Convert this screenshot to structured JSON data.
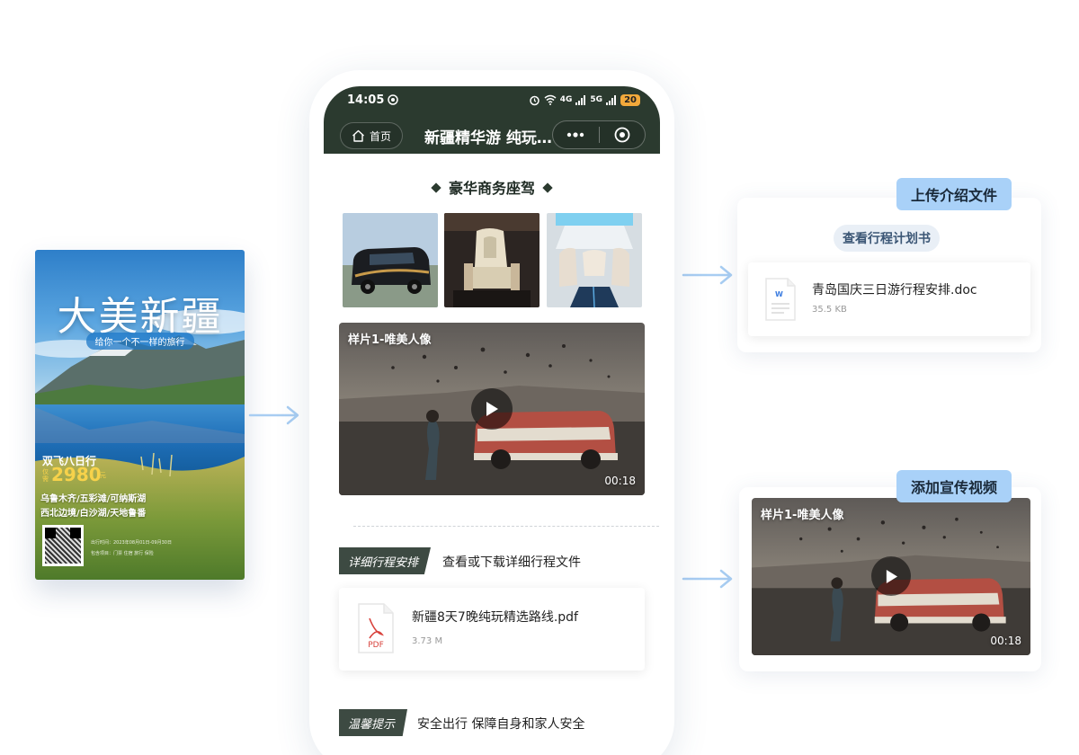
{
  "poster": {
    "title": "大美新疆",
    "subtitle": "给你一个不一样的旅行",
    "tagline": "双飞八日行",
    "price_prefix": "仅需",
    "price": "2980",
    "price_unit": "元",
    "route_line1": "乌鲁木齐/五彩滩/可纳斯湖",
    "route_line2": "西北边境/白沙湖/天地鲁番",
    "small_line1": "出行时间：2023年08月01日-09月30日",
    "small_line2": "包含项目：门票 住宿 旅行 保险"
  },
  "phone": {
    "status": {
      "time": "14:05",
      "signal1": "4G",
      "signal2": "5G",
      "battery": "20"
    },
    "nav": {
      "home_label": "首页",
      "title": "新疆精华游 纯玩八日行"
    },
    "section_title": "豪华商务座驾",
    "video": {
      "label": "样片1-唯美人像",
      "duration": "00:18"
    },
    "itinerary": {
      "badge": "详细行程安排",
      "desc": "查看或下载详细行程文件",
      "file_name": "新疆8天7晚纯玩精选路线.pdf",
      "file_size": "3.73 M",
      "file_type": "PDF"
    },
    "tips": {
      "badge": "温馨提示",
      "desc": "安全出行 保障自身和家人安全"
    }
  },
  "panel_upload": {
    "tag": "上传介绍文件",
    "pill": "查看行程计划书",
    "file_name": "青岛国庆三日游行程安排.doc",
    "file_size": "35.5 KB",
    "file_type": "W"
  },
  "panel_video": {
    "tag": "添加宣传视频",
    "label": "样片1-唯美人像",
    "duration": "00:18"
  },
  "colors": {
    "nav_bg": "#2b3a2f",
    "tag_bg": "#a9d1f8",
    "badge_bg": "#3d4a42",
    "arrow": "#a8cdf2"
  },
  "icons": [
    "home-icon",
    "menu-dots-icon",
    "target-icon",
    "play-icon",
    "pdf-file-icon",
    "word-file-icon",
    "arrow-right-icon"
  ]
}
